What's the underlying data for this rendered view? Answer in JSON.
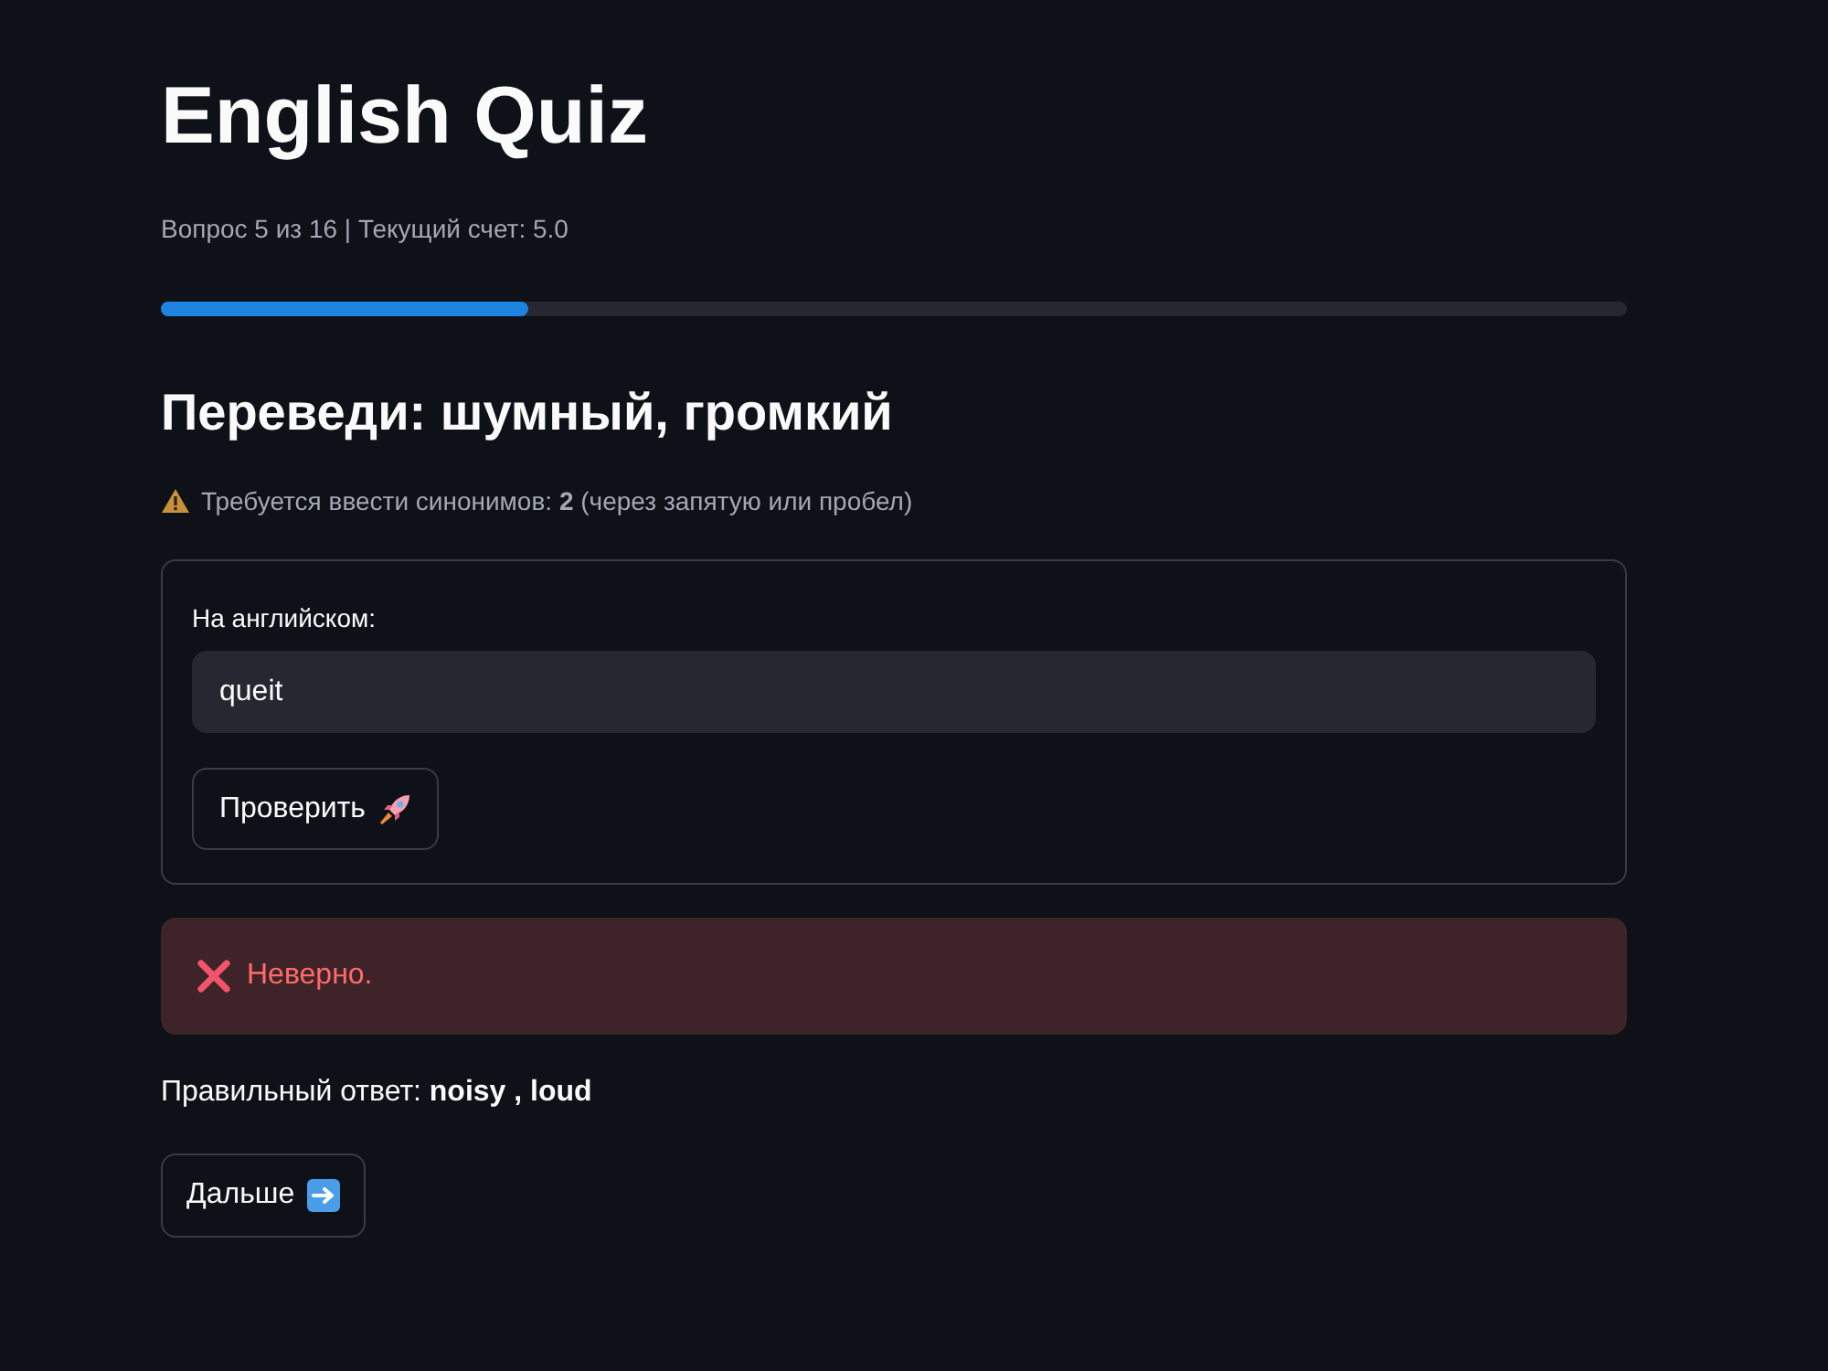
{
  "title": "English Quiz",
  "status": "Вопрос 5 из 16 | Текущий счет: 5.0",
  "progress": {
    "level": 0.25
  },
  "question": "Переведи: шумный, громкий",
  "hint": {
    "kind": "warning",
    "text": "Требуется ввести синонимов: **2** (через запятую или пробел)"
  },
  "form": {
    "label": "На английском:",
    "input": {
      "value": "queit"
    },
    "submit_button": "Проверить"
  },
  "alert": {
    "kind": "error",
    "text": "Неверно."
  },
  "answer": "Правильный ответ: **noisy , loud**",
  "next_button": "Дальше"
}
